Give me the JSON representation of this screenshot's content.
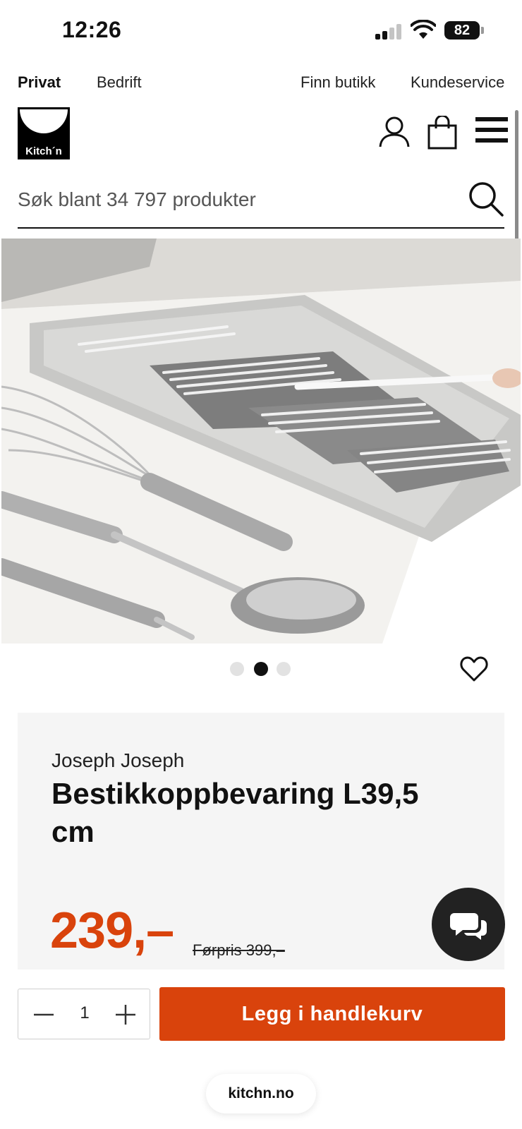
{
  "status_bar": {
    "time": "12:26",
    "battery": "82"
  },
  "top_nav": {
    "private": "Privat",
    "business": "Bedrift",
    "find_store": "Finn butikk",
    "customer_service": "Kundeservice"
  },
  "header": {
    "logo_text": "Kitch´n",
    "icons": [
      "user-icon",
      "bag-icon",
      "menu-icon"
    ]
  },
  "search": {
    "placeholder": "Søk blant 34 797 produkter",
    "value": ""
  },
  "carousel": {
    "total": 3,
    "active_index": 2
  },
  "product": {
    "brand": "Joseph Joseph",
    "title": "Bestikkoppbevaring L39,5 cm",
    "price": "239,–",
    "old_price": "Førpris 399,–"
  },
  "cart": {
    "quantity": "1",
    "add_label": "Legg i handlekurv"
  },
  "browser": {
    "url": "kitchn.no"
  },
  "colors": {
    "accent": "#d9430c",
    "card_bg": "#f5f5f5"
  }
}
